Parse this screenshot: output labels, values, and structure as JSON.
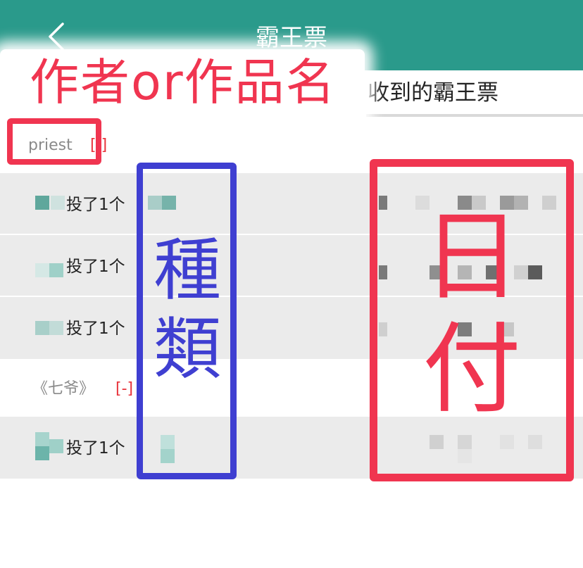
{
  "header": {
    "title": "霸王票",
    "back_icon": "chevron-left-icon",
    "background": "#2a9a8b"
  },
  "tabs": {
    "received_label": "收到的霸王票"
  },
  "groups": [
    {
      "name": "priest",
      "toggle": "[ ]",
      "items": [
        {
          "text": "投了1个"
        },
        {
          "text": "投了1个"
        },
        {
          "text": "投了1个"
        }
      ]
    },
    {
      "name": "《七爷》",
      "toggle": "[-]",
      "items": [
        {
          "text": "投了1个"
        }
      ]
    }
  ],
  "annotations": {
    "author_label": "作者or作品名",
    "type_label": "種類",
    "date_label": "日付",
    "colors": {
      "red": "#f03550",
      "blue": "#3f3fd1"
    }
  }
}
